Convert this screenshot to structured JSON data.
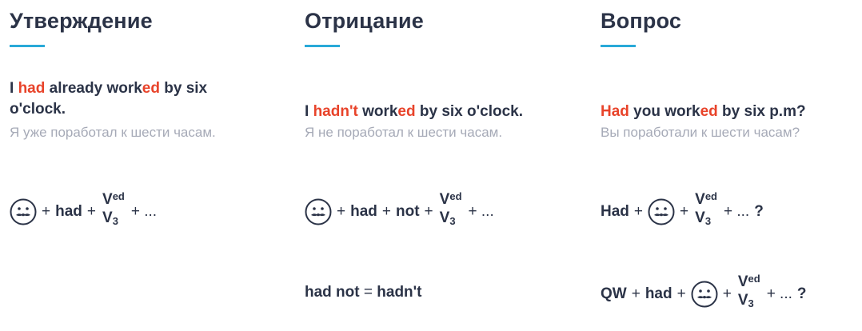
{
  "columns": [
    {
      "title": "Утверждение",
      "example": {
        "p1": "I ",
        "p2": "had",
        "p3": " already work",
        "p4": "ed",
        "p5": " by six o'clock."
      },
      "translation": "Я уже поработал к шести часам.",
      "formula": {
        "w1": "had",
        "plus": "+",
        "ellipsis": "+ ..."
      }
    },
    {
      "title": "Отрицание",
      "example": {
        "p1": "I ",
        "p2": "hadn't",
        "p3": " work",
        "p4": "ed",
        "p5": " by six o'clock."
      },
      "translation": "Я не поработал к шести часам.",
      "formula": {
        "w1": "had",
        "w2": "not",
        "plus": "+",
        "ellipsis": "+ ..."
      },
      "note": {
        "left": "had not",
        "eq": "=",
        "right": "hadn't"
      }
    },
    {
      "title": "Вопрос",
      "example": {
        "p1": "",
        "p2": "Had",
        "p3": " you work",
        "p4": "ed",
        "p5": " by six p.m?"
      },
      "translation": "Вы поработали к шести часам?",
      "formula": {
        "w0": "Had",
        "plus": "+",
        "ellipsis": "+ ...",
        "q": "?"
      },
      "formula2": {
        "w0": "QW",
        "w1": "had",
        "plus": "+",
        "ellipsis": "+ ...",
        "q": "?"
      }
    }
  ],
  "verb": {
    "v": "V",
    "ed": "ed",
    "three": "3"
  },
  "colors": {
    "text": "#2b3347",
    "accent_red": "#e8432a",
    "underline": "#29a9d8",
    "translation": "#a6aab7"
  },
  "icons": {
    "subject": "mustache-face-icon"
  }
}
